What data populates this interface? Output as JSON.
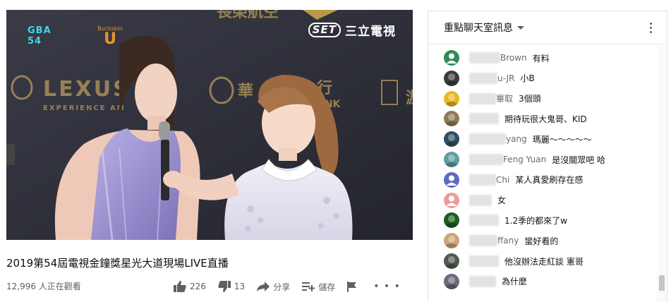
{
  "video": {
    "broadcaster_badge": "SET",
    "broadcaster_name": "三立電視",
    "event_logo": [
      "GBA",
      "54"
    ],
    "sponsor_logo_small": "Buckskin",
    "sponsor_logo_big": "U"
  },
  "video_title": "2019第54屆電視金鐘獎星光大道現場LIVE直播",
  "view_count": "12,996 人正在觀看",
  "actions": {
    "like_count": "226",
    "dislike_count": "13",
    "share_label": "分享",
    "save_label": "儲存"
  },
  "chat": {
    "title": "重點聊天室訊息",
    "messages": [
      {
        "author": "Brown",
        "text": "有料",
        "avatar_color": "#2e8b57",
        "avatar_icon": "user-icon"
      },
      {
        "author": "u-JR",
        "text": "小B",
        "avatar_color": "#3b3b3b",
        "avatar_icon": "photo-avatar"
      },
      {
        "author": "畢取",
        "text": "3個頭",
        "avatar_color": "#e8b820",
        "avatar_icon": "photo-avatar"
      },
      {
        "author": "",
        "text": "期待玩很大鬼哥、KID",
        "avatar_color": "#8c7a55",
        "avatar_icon": "photo-avatar"
      },
      {
        "author": "yang",
        "text": "瑪麗～～～～～",
        "avatar_color": "#2f4f5f",
        "avatar_icon": "photo-avatar"
      },
      {
        "author": "Feng Yuan",
        "text": "是沒關眾吧 哈",
        "avatar_color": "#5f9ea0",
        "avatar_icon": "photo-avatar"
      },
      {
        "author": "Chi",
        "text": "某人真愛刷存在感",
        "avatar_color": "#5c6bc0",
        "avatar_icon": "user-icon"
      },
      {
        "author": "",
        "text": "女",
        "avatar_color": "#ef9a9a",
        "avatar_icon": "user-icon"
      },
      {
        "author": "",
        "text": "1.2季的都來了w",
        "avatar_color": "#1b5e20",
        "avatar_icon": "photo-avatar"
      },
      {
        "author": "ffany",
        "text": "蠻好看的",
        "avatar_color": "#c9a57a",
        "avatar_icon": "photo-avatar"
      },
      {
        "author": "",
        "text": "他沒辦法走紅談 憲哥",
        "avatar_color": "#4e5a4e",
        "avatar_icon": "photo-avatar"
      },
      {
        "author": "",
        "text": "為什麼",
        "avatar_color": "#6a6a7a",
        "avatar_icon": "photo-avatar"
      }
    ]
  }
}
